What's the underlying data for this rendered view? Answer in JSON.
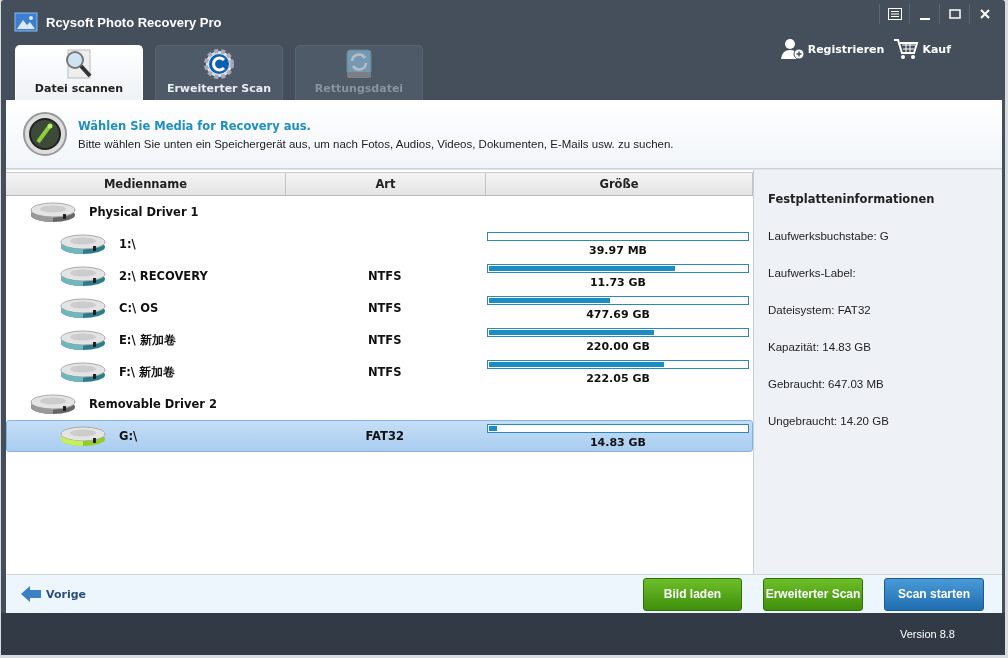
{
  "window": {
    "title": "Rcysoft Photo Recovery Pro"
  },
  "tabs": [
    {
      "label": "Datei scannen",
      "kind": "search",
      "selected": true,
      "disabled": false
    },
    {
      "label": "Erweiterter Scan",
      "kind": "gear",
      "selected": false,
      "disabled": false
    },
    {
      "label": "Rettungsdatei",
      "kind": "restore",
      "selected": false,
      "disabled": true
    }
  ],
  "header_links": [
    {
      "label": "Registrieren",
      "kind": "user"
    },
    {
      "label": "Kauf",
      "kind": "cart"
    }
  ],
  "banner": {
    "title": "Wählen Sie Media for Recovery aus.",
    "text": "Bitte wählen Sie unten ein Speichergerät aus, um nach Fotos, Audios, Videos, Dokumenten, E-Mails usw. zu suchen."
  },
  "table": {
    "columns": [
      "Medienname",
      "Art",
      "Größe"
    ],
    "rows": [
      {
        "name": "Physical Driver 1",
        "children": [
          {
            "name": "1:\\",
            "size": "39.97 MB",
            "level": 0,
            "selected": false
          },
          {
            "name": "2:\\ RECOVERY",
            "type": "NTFS",
            "size": "11.73 GB",
            "level": 0.72,
            "selected": false
          },
          {
            "name": "C:\\ OS",
            "type": "NTFS",
            "size": "477.69 GB",
            "level": 0.47,
            "selected": false
          },
          {
            "name": "E:\\ 新加卷",
            "type": "NTFS",
            "size": "220.00 GB",
            "level": 0.64,
            "selected": false
          },
          {
            "name": "F:\\ 新加卷",
            "type": "NTFS",
            "size": "222.05 GB",
            "level": 0.68,
            "selected": false
          }
        ]
      },
      {
        "name": "Removable Driver 2",
        "children": [
          {
            "name": "G:\\",
            "type": "FAT32",
            "size": "14.83 GB",
            "level": 0.03,
            "selected": true
          }
        ]
      }
    ]
  },
  "info": {
    "title": "Festplatteninformationen",
    "lines": [
      "Laufwerksbuchstabe: G",
      "Laufwerks-Label:",
      "Dateisystem: FAT32",
      "Kapazität: 14.83 GB",
      "Gebraucht: 647.03 MB",
      "Ungebraucht: 14.20 GB"
    ]
  },
  "back": {
    "label": "Vorige"
  },
  "buttons": [
    {
      "label": "Bild laden",
      "kind": "green"
    },
    {
      "label": "Erweiterter Scan",
      "kind": "green"
    },
    {
      "label": "Scan starten",
      "kind": "blue"
    }
  ],
  "status_bar": {
    "version": "Version 8.8"
  }
}
